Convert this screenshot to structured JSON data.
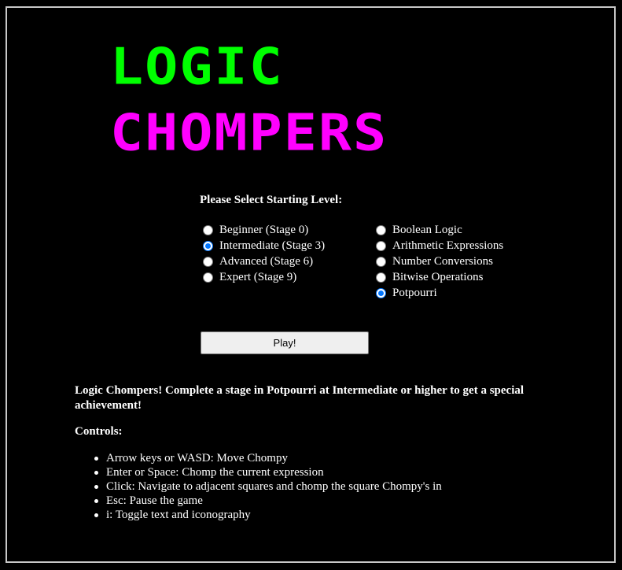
{
  "colors": {
    "background": "#000000",
    "logo_line_1": "#00ff00",
    "logo_line_2": "#ff00ff",
    "text": "#ffffff",
    "radio_checked": "#0075ff"
  },
  "logo": {
    "line1": "LOGIC",
    "line2": "CHOMPERS"
  },
  "level_select": {
    "heading": "Please Select Starting Level:",
    "levels": [
      {
        "label": "Beginner (Stage 0)",
        "checked": false
      },
      {
        "label": "Intermediate (Stage 3)",
        "checked": true
      },
      {
        "label": "Advanced (Stage 6)",
        "checked": false
      },
      {
        "label": "Expert (Stage 9)",
        "checked": false
      }
    ],
    "categories": [
      {
        "label": "Boolean Logic",
        "checked": false
      },
      {
        "label": "Arithmetic Expressions",
        "checked": false
      },
      {
        "label": "Number Conversions",
        "checked": false
      },
      {
        "label": "Bitwise Operations",
        "checked": false
      },
      {
        "label": "Potpourri",
        "checked": true
      }
    ]
  },
  "play_button": {
    "label": "Play!"
  },
  "info": {
    "achievement_text": "Logic Chompers! Complete a stage in Potpourri at Intermediate or higher to get a special achievement!",
    "controls_heading": "Controls:",
    "controls": [
      "Arrow keys or WASD: Move Chompy",
      "Enter or Space: Chomp the current expression",
      "Click: Navigate to adjacent squares and chomp the square Chompy's in",
      "Esc: Pause the game",
      "i: Toggle text and iconography"
    ]
  }
}
